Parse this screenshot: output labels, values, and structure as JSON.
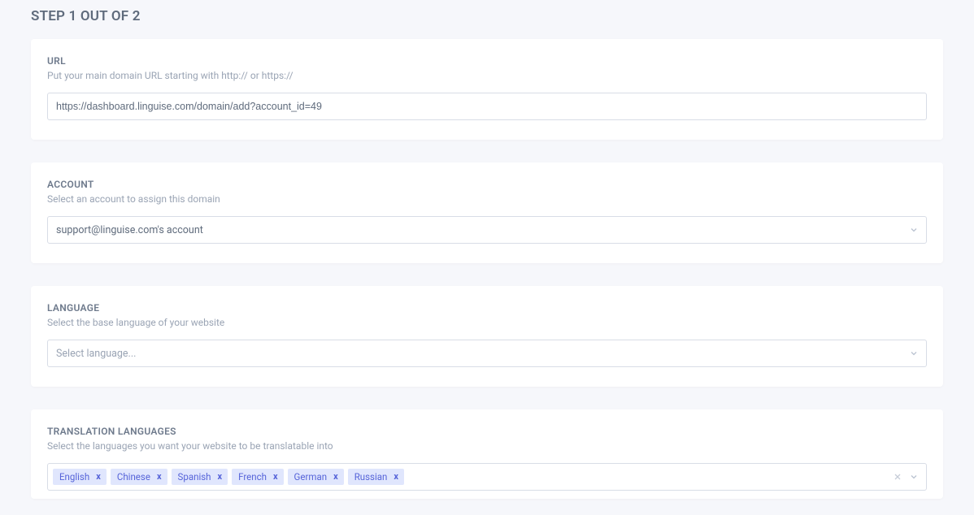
{
  "step_heading": "STEP 1 OUT OF 2",
  "url_section": {
    "label": "URL",
    "description": "Put your main domain URL starting with http:// or https://",
    "value": "https://dashboard.linguise.com/domain/add?account_id=49"
  },
  "account_section": {
    "label": "ACCOUNT",
    "description": "Select an account to assign this domain",
    "selected": "support@linguise.com's account"
  },
  "language_section": {
    "label": "LANGUAGE",
    "description": "Select the base language of your website",
    "placeholder": "Select language..."
  },
  "translation_section": {
    "label": "TRANSLATION LANGUAGES",
    "description": "Select the languages you want your website to be translatable into",
    "selected": [
      "English",
      "Chinese",
      "Spanish",
      "French",
      "German",
      "Russian"
    ]
  }
}
